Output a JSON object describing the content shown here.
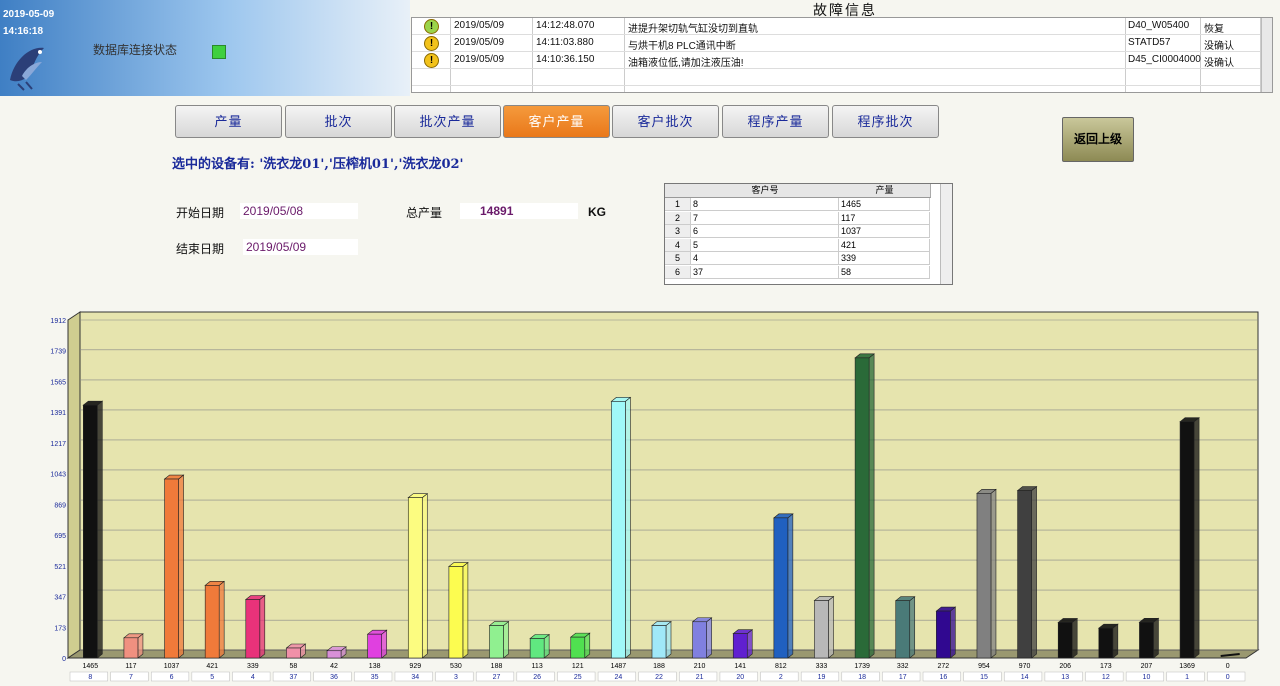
{
  "header": {
    "date": "2019-05-09",
    "time": "14:16:18",
    "db_status_label": "数据库连接状态",
    "db_status_color": "#3fd03f"
  },
  "fault": {
    "title": "故障信息",
    "rows": [
      {
        "icon": "ok-icon",
        "date": "2019/05/09",
        "time": "14:12:48.070",
        "message": "进提升架切轨气缸没切到直轨",
        "code": "D40_W05400",
        "status": "恢复"
      },
      {
        "icon": "warning-icon",
        "date": "2019/05/09",
        "time": "14:11:03.880",
        "message": "与烘干机8 PLC通讯中断",
        "code": "STATD57",
        "status": "没确认"
      },
      {
        "icon": "warning-icon",
        "date": "2019/05/09",
        "time": "14:10:36.150",
        "message": "油箱液位低,请加注液压油!",
        "code": "D45_CI0004000",
        "status": "没确认"
      }
    ]
  },
  "tabs": [
    {
      "label": "产量",
      "active": false
    },
    {
      "label": "批次",
      "active": false
    },
    {
      "label": "批次产量",
      "active": false
    },
    {
      "label": "客户产量",
      "active": true
    },
    {
      "label": "客户批次",
      "active": false
    },
    {
      "label": "程序产量",
      "active": false
    },
    {
      "label": "程序批次",
      "active": false
    }
  ],
  "back_label": "返回上级",
  "selected_devices": "选中的设备有: '洗衣龙01','压榨机01','洗衣龙02'",
  "filters": {
    "start_label": "开始日期",
    "start_value": "2019/05/08",
    "end_label": "结束日期",
    "end_value": "2019/05/09",
    "total_label": "总产量",
    "total_value": "14891",
    "total_unit": "KG"
  },
  "table": {
    "headers": [
      "客户号",
      "产量"
    ],
    "rows": [
      {
        "n": "1",
        "customer": "8",
        "qty": "1465"
      },
      {
        "n": "2",
        "customer": "7",
        "qty": "117"
      },
      {
        "n": "3",
        "customer": "6",
        "qty": "1037"
      },
      {
        "n": "4",
        "customer": "5",
        "qty": "421"
      },
      {
        "n": "5",
        "customer": "4",
        "qty": "339"
      },
      {
        "n": "6",
        "customer": "37",
        "qty": "58"
      }
    ]
  },
  "chart_data": {
    "type": "bar",
    "ylim": [
      0,
      1912
    ],
    "yticks": [
      "0",
      "173",
      "347",
      "521",
      "695",
      "869",
      "1043",
      "1217",
      "1391",
      "1565",
      "1739",
      "1912"
    ],
    "background": "#e6e4ae",
    "categories": [
      "8",
      "7",
      "6",
      "5",
      "4",
      "37",
      "36",
      "35",
      "34",
      "3",
      "27",
      "26",
      "25",
      "24",
      "22",
      "21",
      "20",
      "2",
      "19",
      "18",
      "17",
      "16",
      "15",
      "14",
      "13",
      "12",
      "10",
      "1",
      "0"
    ],
    "values": [
      1465,
      117,
      1037,
      421,
      339,
      58,
      42,
      138,
      929,
      530,
      188,
      113,
      121,
      1487,
      188,
      210,
      141,
      812,
      333,
      1739,
      332,
      272,
      954,
      970,
      206,
      173,
      207,
      1369,
      0
    ],
    "colors": [
      "#111111",
      "#f09080",
      "#f07a3a",
      "#f07a3a",
      "#e8327a",
      "#f090a8",
      "#d890d8",
      "#e040e0",
      "#fcfc80",
      "#fcfc50",
      "#90f090",
      "#60e880",
      "#50e050",
      "#a0f8f8",
      "#a0e8f8",
      "#8080e0",
      "#6020d0",
      "#2060c0",
      "#b8b8b8",
      "#2a6a38",
      "#4a7a78",
      "#300890",
      "#808080",
      "#404040",
      "#111111",
      "#111111",
      "#111111",
      "#111111",
      "#111111"
    ]
  }
}
